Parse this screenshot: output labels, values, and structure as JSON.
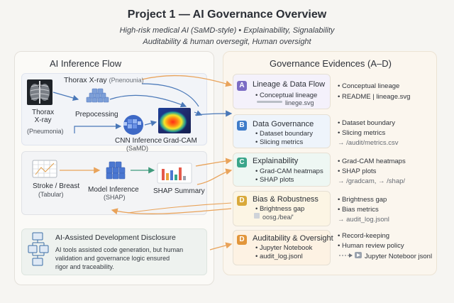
{
  "header": {
    "title": "Project 1 — AI Governance Overview",
    "subtitle1": "High-risk medical AI (SaMD-style) • Explainability, Signalability",
    "subtitle2": "Auditability & human oversegit, Human oversight"
  },
  "left": {
    "title": "AI Inference Flow",
    "flow1": {
      "top_label": "Thorax X-ray",
      "top_label_note": "(Pnenounia)",
      "xray_label_line1": "Thorax",
      "xray_label_line2": "X-ray",
      "xray_note": "(Pneumonia)",
      "preprocessing": "Prepocessing",
      "cnn_label": "CNN Inference",
      "cnn_note": "(SaMD)",
      "gradcam": "Grad-CAM"
    },
    "flow2": {
      "input_label": "Stroke / Breast",
      "input_note": "(Tabular)",
      "model_label": "Model Inference",
      "model_note": "(SHAP)",
      "shap": "SHAP Summary"
    },
    "disclosure": {
      "title": "AI-Assisted Development Disclosure",
      "body_line1": "AI tools assisted code generation, but human",
      "body_line2": "validation and governance logic ensured",
      "body_line3": "rigor and traceability."
    }
  },
  "right": {
    "title": "Governance Evidences (A–D)",
    "cards": [
      {
        "badge": "A",
        "color": "#7b6cc4",
        "bg": "#f4f1fb",
        "title": "Lineage & Data Flow",
        "items": [
          "• Conceptual lineage"
        ],
        "file": "linege.svg",
        "refs": [
          "• Conceptual lineage",
          "• README | lineage.svg"
        ]
      },
      {
        "badge": "B",
        "color": "#3f7cc9",
        "bg": "#eef4fb",
        "title": "Data Governance",
        "items": [
          "• Dataset boundary",
          "• Slicing metrics"
        ],
        "refs": [
          "• Dataset boundary",
          "• Slicing metrics",
          "→ /audit/metrics.csv"
        ]
      },
      {
        "badge": "C",
        "color": "#3aa58a",
        "bg": "#eef7f3",
        "title": "Explainability",
        "items": [
          "• Grad-CAM heatmaps",
          "• SHAP plots"
        ],
        "refs": [
          "• Grad-CAM heatmaps",
          "• SHAP plots",
          "→ /gradcam, → /shap/"
        ]
      },
      {
        "badge": "D",
        "color": "#d9a93a",
        "bg": "#fcf5e4",
        "title": "Bias & Robustness",
        "items": [
          "• Brightness gap"
        ],
        "file": "oosg./bea/'",
        "refs": [
          "• Brightness gap",
          "• Bias metrics",
          "→ audit_log.jsonl"
        ]
      },
      {
        "badge": "D",
        "color": "#e2963b",
        "bg": "#fdf2e3",
        "title": "Auditability & Oversight",
        "items": [
          "• Jupyter Notebook",
          "• audit_log.jsonl"
        ],
        "refs": [
          "• Record-keeping",
          "• Human review policy",
          "Jupyter Noteboor jsonl"
        ]
      }
    ]
  }
}
